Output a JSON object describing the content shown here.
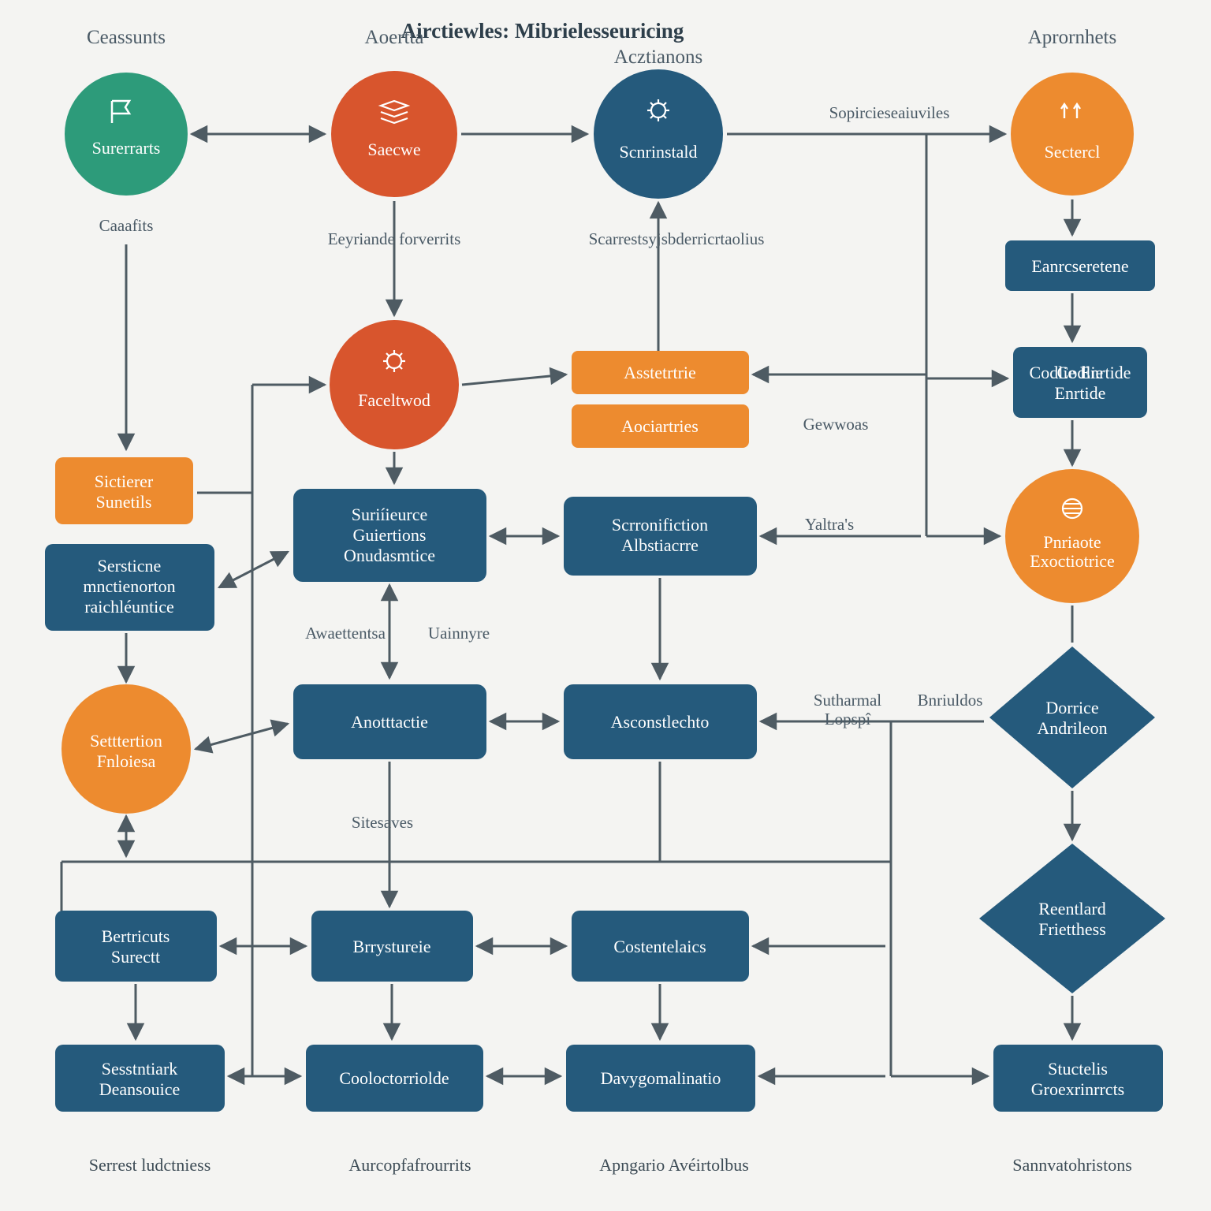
{
  "title": "Airctiewles: Mibrielesseuricing",
  "columns": {
    "c1": "Ceassunts",
    "c2": "Aoertta",
    "c3": "Acztianons",
    "c4": "Aprornhets"
  },
  "captions": {
    "b1": "Serrest ludctniess",
    "b2": "Aurcopfafrourrits",
    "b3": "Apngario Avéirtolbus",
    "b4": "Sannvatohristons"
  },
  "nodes": {
    "n_surerats": "Surerrarts",
    "n_secwe": "Saecwe",
    "n_scrinstald": "Scnrinstald",
    "n_sectecl": "Sectercl",
    "n_facelwod": "Faceltwod",
    "n_sictirer": "Sictierer Sunetils",
    "n_serticne": "Sersticne mnctienorton raichléuntice",
    "n_settertion": "Setttertion Fnloiesa",
    "n_asstrtie": "Asstetrtrie",
    "n_acarines": "Aociartries",
    "n_suriieurce": "Suriíieurce Guiertions Onudasmtice",
    "n_scronfiction": "Scrronifiction Albstiacrre",
    "n_anottactie": "Anotttactie",
    "n_asconstecto": "Asconstlechto",
    "n_eanceretene": "Eanrcseretene",
    "n_codie": "Codlie Enrtide",
    "n_pricote": "Pnriaote Exoctiotrice",
    "n_dorice": "Dorrice Andrileon",
    "n_reentiard": "Reentlard Frietthess",
    "n_berticuts": "Bertricuts Surectt",
    "n_brysurate": "Brrystureie",
    "n_costentcies": "Costentelaics",
    "n_sestriarc": "Sesstntiark Deansouice",
    "n_cooloctoriole": "Cooloctorriolde",
    "n_davgomalnatio": "Davygomalinatio",
    "n_suctels": "Stuctelis Groexrinrrcts"
  },
  "edge_labels": {
    "e_caafts": "Caaafits",
    "e_eeyiande": "Eeyriande forverrits",
    "e_scarestys": "Scarrestsyjsbderricrtaolius",
    "e_sopiceseauviles": "Sopircieseaiuviles",
    "e_gewoas": "Gewwoas",
    "e_yatras": "Yaltra's",
    "e_awatentsa": "Awaettentsa",
    "e_uainye": "Uainnyre",
    "e_sutamat": "Sutharmal Lopspî",
    "e_briuldos": "Bnriuldos",
    "e_siesaves": "Sitesaves"
  },
  "colors": {
    "blue": "#255a7c",
    "orange": "#ed8b2f",
    "red": "#d8552d",
    "green": "#2d9b7a",
    "arrow": "#4e5b63",
    "bg": "#f4f4f2"
  }
}
